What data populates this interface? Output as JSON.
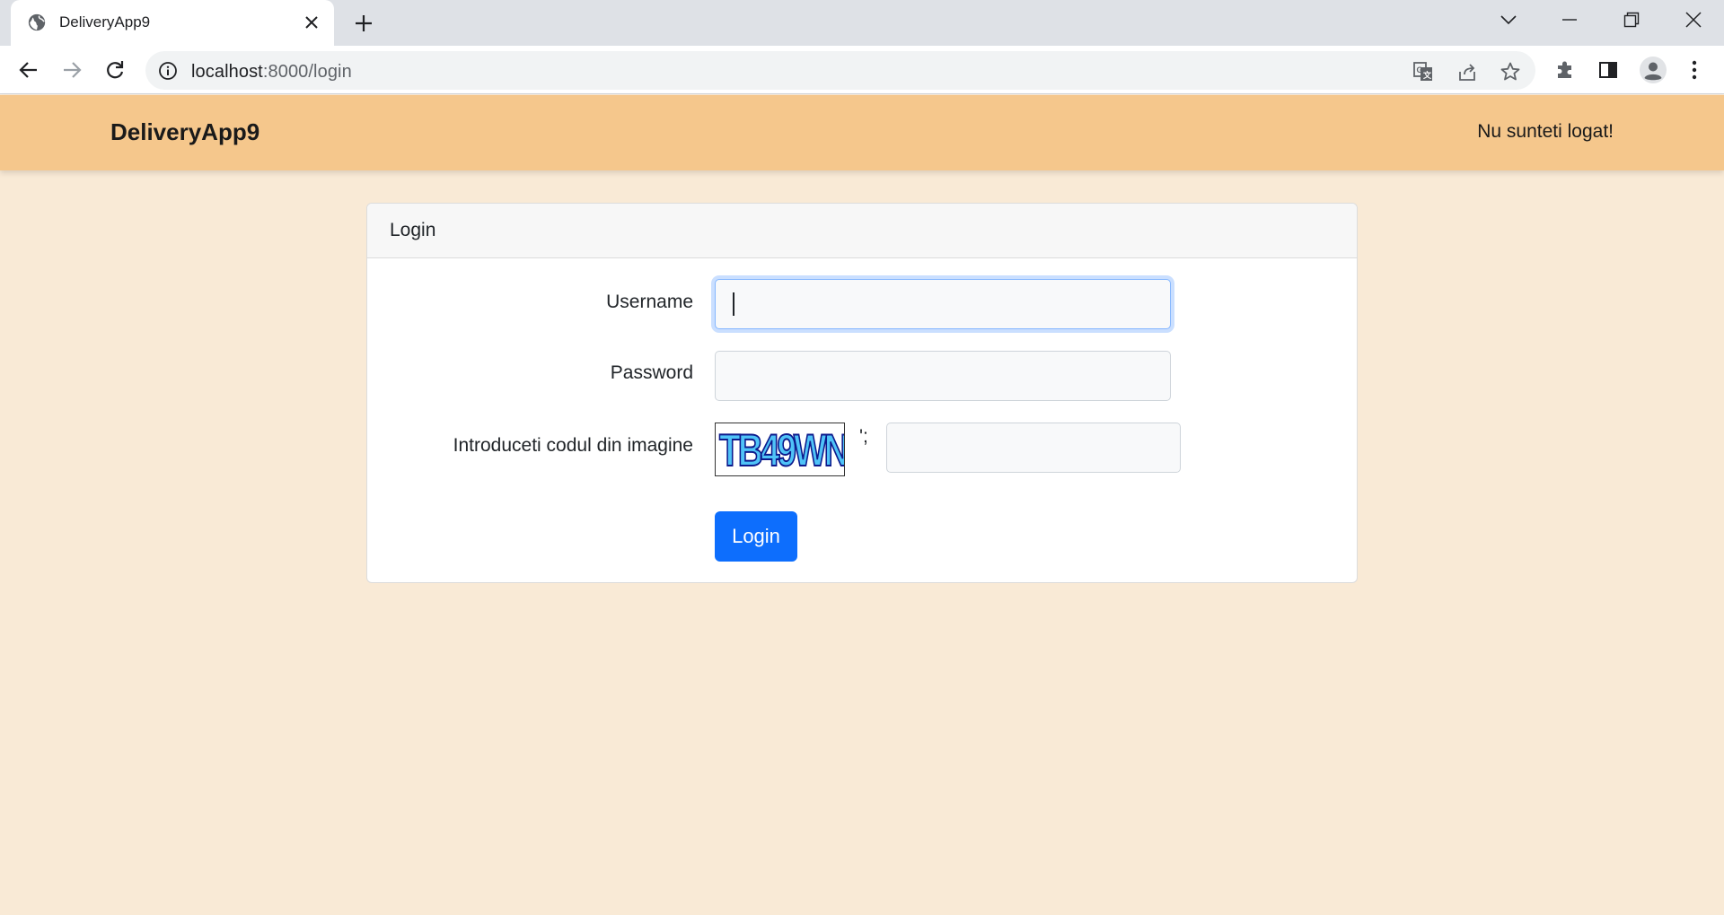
{
  "browser": {
    "tab_title": "DeliveryApp9",
    "url_host": "localhost",
    "url_path": ":8000/login"
  },
  "navbar": {
    "brand": "DeliveryApp9",
    "status": "Nu sunteti logat!"
  },
  "login_card": {
    "header": "Login",
    "username_label": "Username",
    "username_value": "",
    "password_label": "Password",
    "password_value": "",
    "captcha_label": "Introduceti codul din imagine",
    "captcha_image_text": "TB49WN",
    "captcha_stray_text": "';",
    "captcha_value": "",
    "submit_label": "Login"
  },
  "colors": {
    "page_background": "#f9ead6",
    "navbar_background": "#f5c78c",
    "primary_button": "#0d6efd"
  },
  "icons": {
    "tab_favicon": "globe-icon",
    "tab_close": "close-icon",
    "new_tab": "plus-icon",
    "tab_search": "chevron-down-icon",
    "minimize": "minimize-icon",
    "restore": "restore-icon",
    "close_window": "close-icon",
    "back": "arrow-left-icon",
    "forward": "arrow-right-icon",
    "reload": "reload-icon",
    "site_info": "info-icon",
    "translate": "translate-icon",
    "share": "share-icon",
    "bookmark": "star-icon",
    "extensions": "puzzle-icon",
    "side_panel": "side-panel-icon",
    "profile": "avatar-icon",
    "menu": "kebab-menu-icon"
  }
}
